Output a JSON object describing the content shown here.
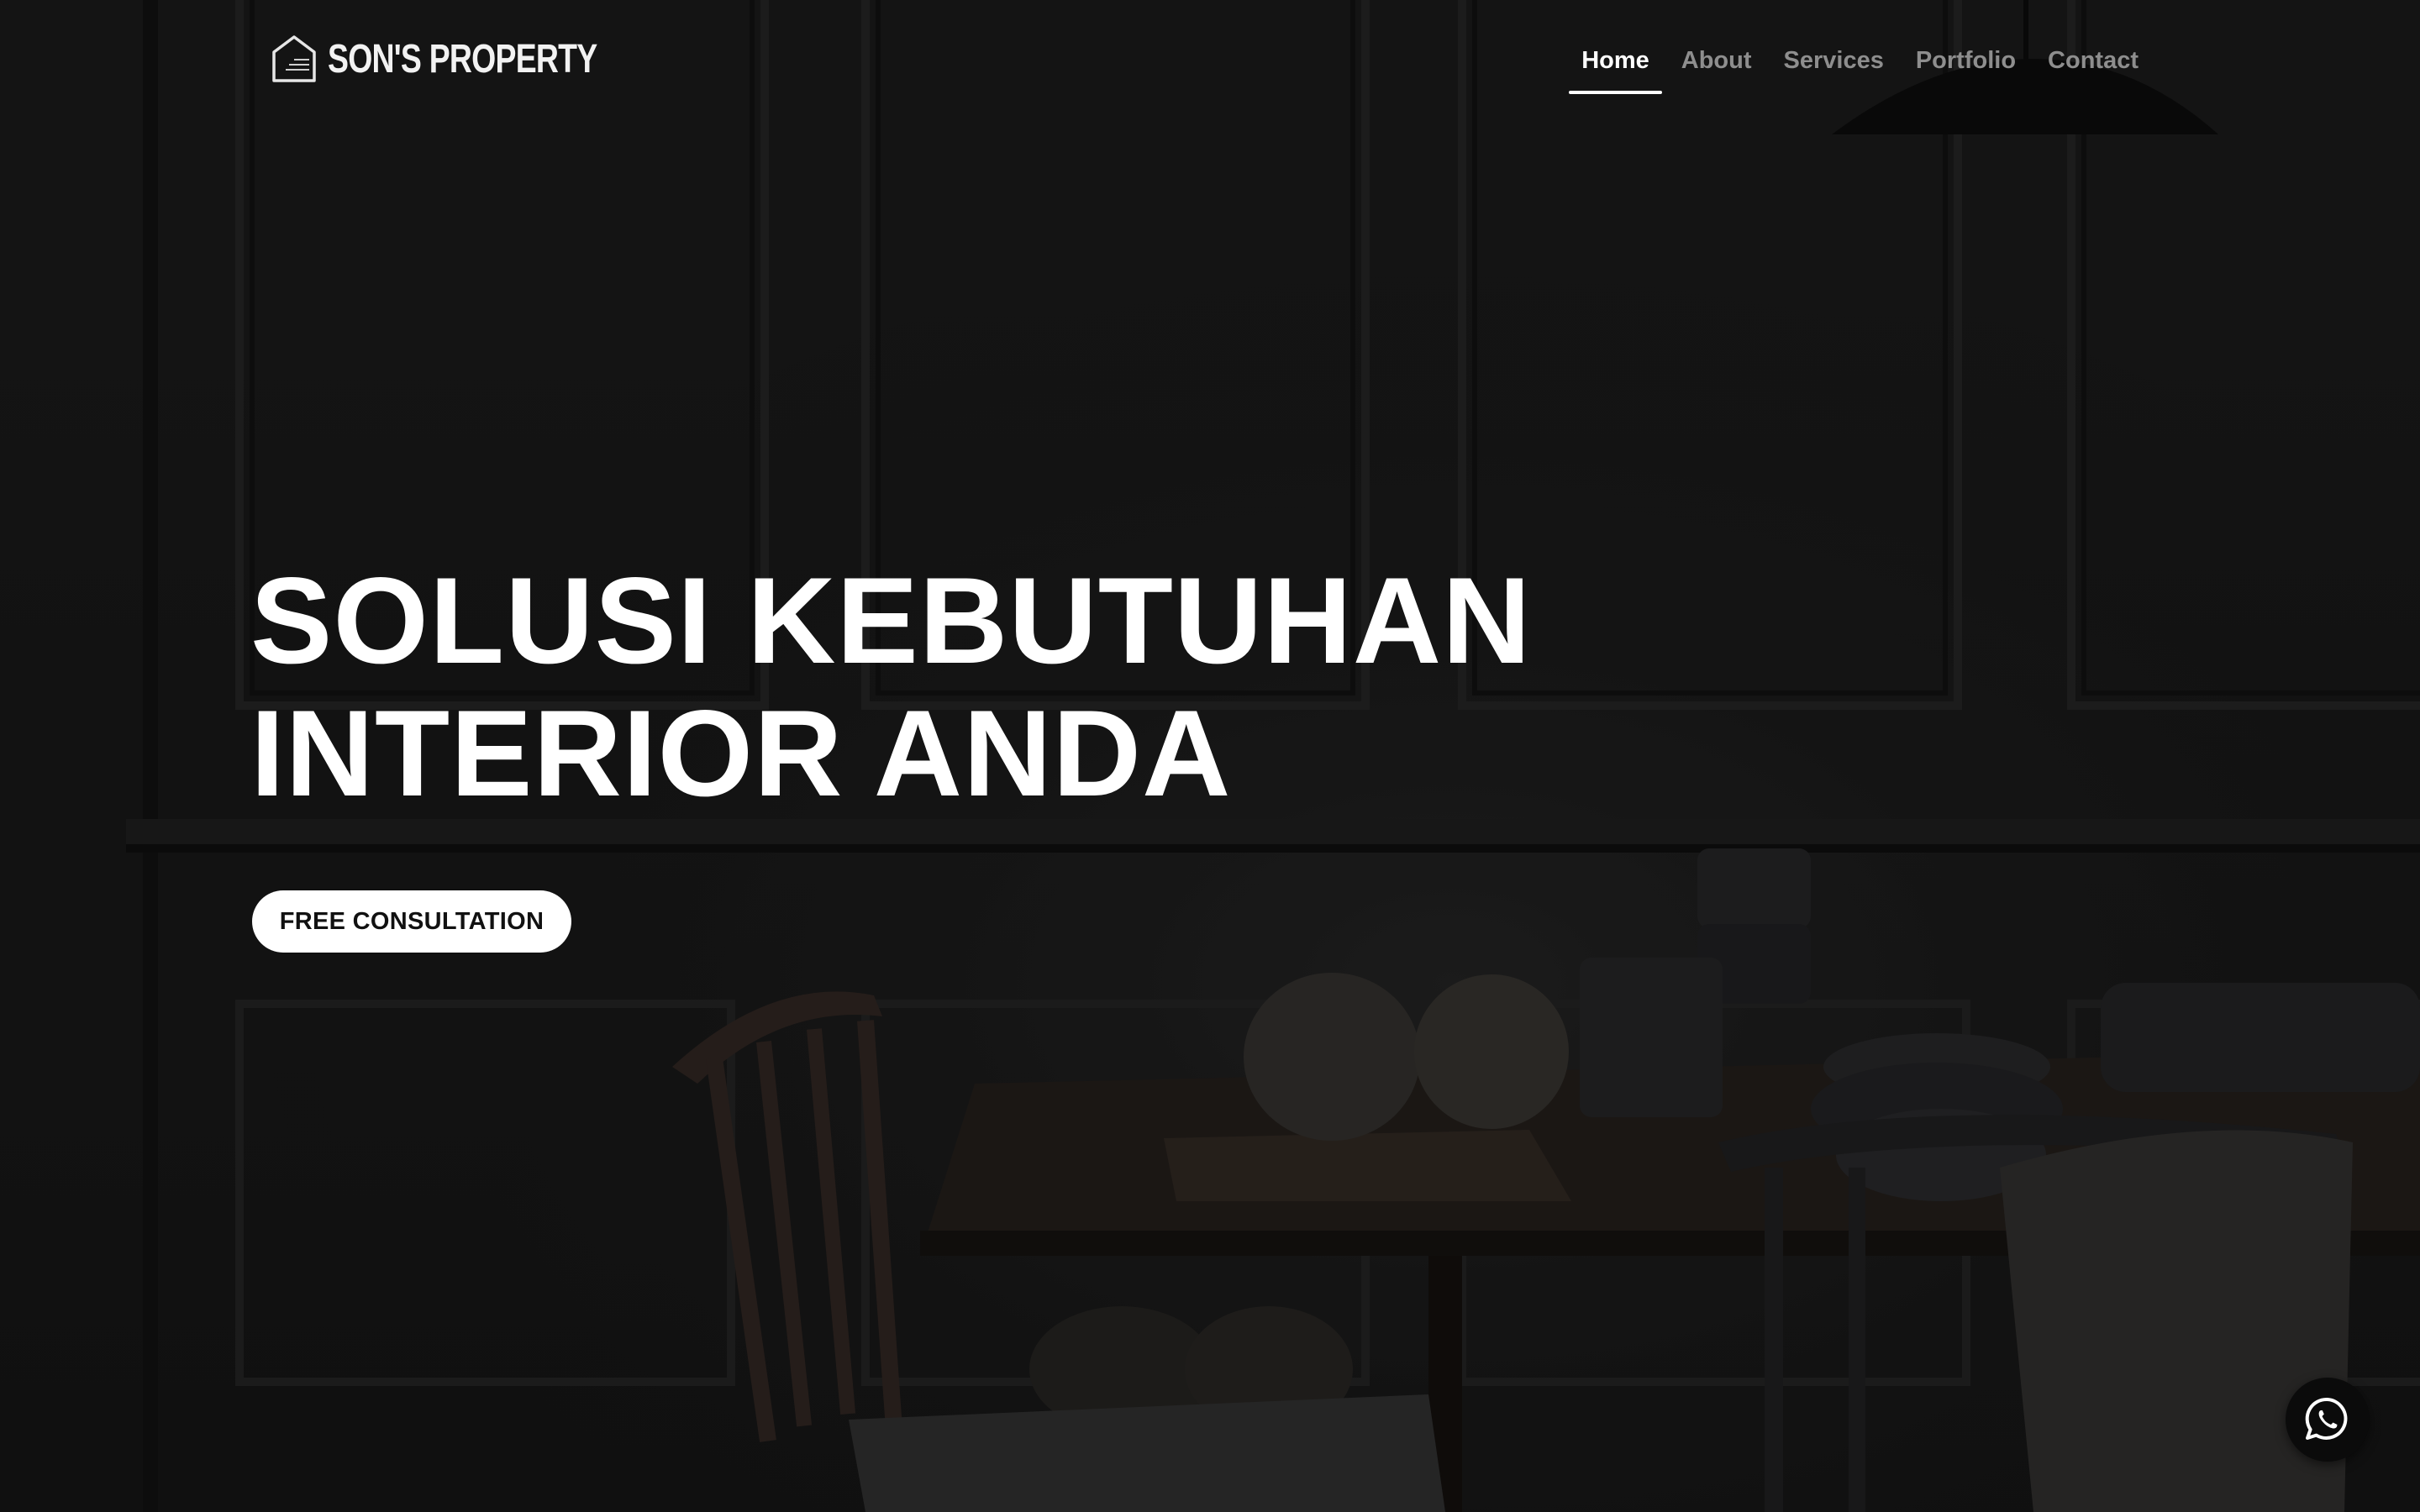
{
  "brand": {
    "name": "SON'S PROPERTY",
    "icon": "house-logo-icon"
  },
  "nav": {
    "items": [
      {
        "label": "Home",
        "active": true
      },
      {
        "label": "About",
        "active": false
      },
      {
        "label": "Services",
        "active": false
      },
      {
        "label": "Portfolio",
        "active": false
      },
      {
        "label": "Contact",
        "active": false
      }
    ]
  },
  "hero": {
    "headline_line1": "SOLUSI KEBUTUHAN",
    "headline_line2": "INTERIOR ANDA",
    "cta_label": "FREE CONSULTATION",
    "background": "dark-dining-room-photo"
  },
  "whatsapp": {
    "icon": "whatsapp-icon"
  },
  "colors": {
    "text": "#ffffff",
    "nav_inactive": "#8e8e8e",
    "background": "#151515",
    "button_bg": "#ffffff",
    "button_text": "#111111"
  }
}
